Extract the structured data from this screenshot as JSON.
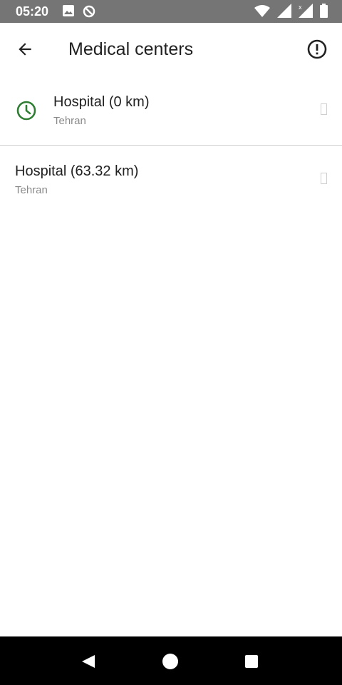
{
  "status_bar": {
    "time": "05:20",
    "left_icons": [
      "image-icon",
      "data-saver-icon"
    ],
    "right_icons": [
      "wifi-icon",
      "signal-icon",
      "no-signal-icon",
      "battery-icon"
    ]
  },
  "app_bar": {
    "title": "Medical centers",
    "back_icon": "arrow-back-icon",
    "action_icon": "info-alert-icon"
  },
  "list": {
    "items": [
      {
        "title": "Hospital (0 km)",
        "subtitle": "Tehran",
        "icon": "clock-icon"
      },
      {
        "title": "Hospital (63.32 km)",
        "subtitle": "Tehran",
        "icon": ""
      }
    ]
  },
  "nav": {
    "buttons": [
      "back-triangle-icon",
      "home-circle-icon",
      "recents-square-icon"
    ]
  },
  "colors": {
    "status_bar": "#757575",
    "accent_green": "#2e7d32",
    "text_primary": "#212121",
    "text_secondary": "#8a8a8a"
  }
}
